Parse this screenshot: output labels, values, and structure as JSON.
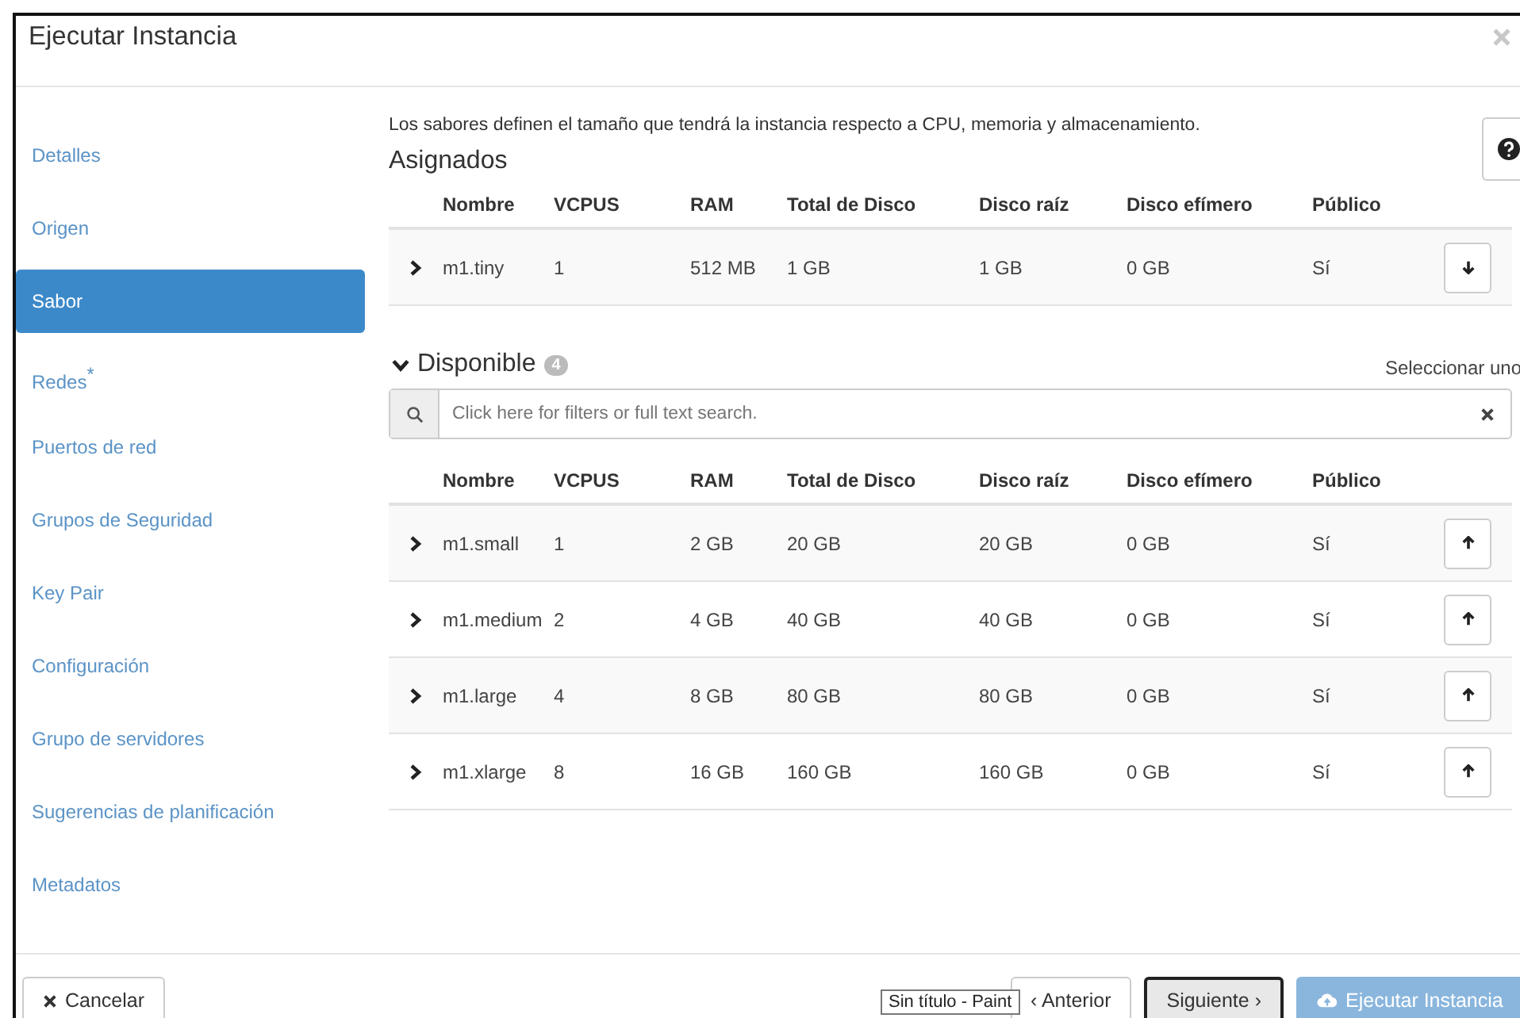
{
  "dialog": {
    "title": "Ejecutar Instancia"
  },
  "sidebar": {
    "items": [
      {
        "label": "Detalles",
        "selected": false
      },
      {
        "label": "Origen",
        "selected": false
      },
      {
        "label": "Sabor",
        "selected": true
      },
      {
        "label": "Redes",
        "selected": false,
        "marker": "*"
      },
      {
        "label": "Puertos de red",
        "selected": false
      },
      {
        "label": "Grupos de Seguridad",
        "selected": false
      },
      {
        "label": "Key Pair",
        "selected": false
      },
      {
        "label": "Configuración",
        "selected": false
      },
      {
        "label": "Grupo de servidores",
        "selected": false
      },
      {
        "label": "Sugerencias de planificación",
        "selected": false
      },
      {
        "label": "Metadatos",
        "selected": false
      }
    ]
  },
  "description": "Los sabores definen el tamaño que tendrá la instancia respecto a CPU, memoria y almacenamiento.",
  "allocated": {
    "title": "Asignados",
    "columns": [
      "Nombre",
      "VCPUS",
      "RAM",
      "Total de Disco",
      "Disco raíz",
      "Disco efímero",
      "Público"
    ],
    "rows": [
      [
        "m1.tiny",
        "1",
        "512 MB",
        "1 GB",
        "1 GB",
        "0 GB",
        "Sí"
      ]
    ]
  },
  "available": {
    "title": "Disponible",
    "expanded": true,
    "count": "4",
    "select_hint": "Seleccionar uno",
    "search": {
      "placeholder": "Click here for filters or full text search."
    },
    "columns": [
      "Nombre",
      "VCPUS",
      "RAM",
      "Total de Disco",
      "Disco raíz",
      "Disco efímero",
      "Público"
    ],
    "rows": [
      [
        "m1.small",
        "1",
        "2 GB",
        "20 GB",
        "20 GB",
        "0 GB",
        "Sí"
      ],
      [
        "m1.medium",
        "2",
        "4 GB",
        "40 GB",
        "40 GB",
        "0 GB",
        "Sí"
      ],
      [
        "m1.large",
        "4",
        "8 GB",
        "80 GB",
        "80 GB",
        "0 GB",
        "Sí"
      ],
      [
        "m1.xlarge",
        "8",
        "16 GB",
        "160 GB",
        "160 GB",
        "0 GB",
        "Sí"
      ]
    ]
  },
  "footer": {
    "buttons": [
      {
        "kind": "cancel",
        "label": "Cancelar",
        "disabled": false,
        "focused": false
      },
      {
        "kind": "back",
        "label": "‹ Anterior",
        "disabled": false,
        "focused": false
      },
      {
        "kind": "next",
        "label": "Siguiente ›",
        "disabled": false,
        "focused": true
      },
      {
        "kind": "launch",
        "label": "Ejecutar Instancia",
        "disabled": true,
        "focused": false
      }
    ]
  },
  "tooltip": "Sin título - Paint"
}
